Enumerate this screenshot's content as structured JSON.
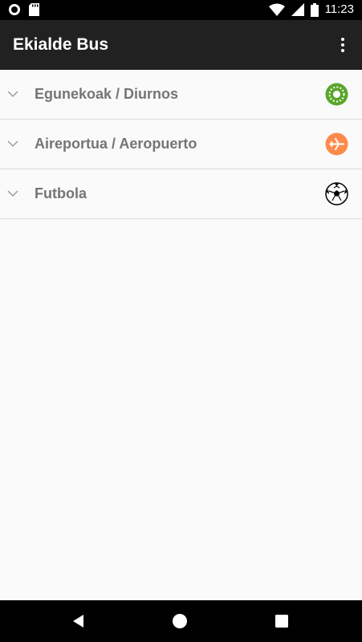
{
  "status_bar": {
    "time": "11:23",
    "icons": [
      "circle-notification-icon",
      "sd-card-icon",
      "wifi-icon",
      "cell-signal-icon",
      "battery-icon"
    ]
  },
  "app_bar": {
    "title": "Ekialde Bus",
    "menu_icon": "more-vert-icon"
  },
  "list": {
    "items": [
      {
        "label": "Egunekoak / Diurnos",
        "icon": "day-service-icon",
        "icon_color": "#5aa52b"
      },
      {
        "label": "Aireportua / Aeropuerto",
        "icon": "airplane-icon",
        "icon_color": "#ff8a4c"
      },
      {
        "label": "Futbola",
        "icon": "soccer-ball-icon",
        "icon_color": "#000000"
      }
    ]
  },
  "nav_bar": {
    "buttons": [
      "back-icon",
      "home-icon",
      "recents-icon"
    ]
  }
}
